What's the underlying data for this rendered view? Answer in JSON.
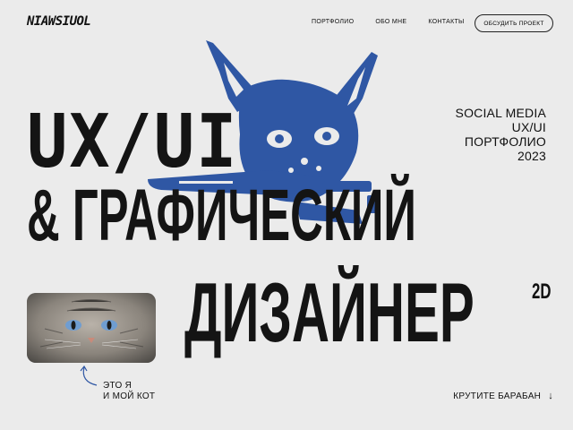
{
  "logo": "NIAWSIUOL",
  "nav": {
    "items": [
      "ПОРТФОЛИО",
      "ОБО МНЕ",
      "КОНТАКТЫ"
    ],
    "cta": "ОБСУДИТЬ ПРОЕКТ"
  },
  "hero": {
    "line1": "UX/UI",
    "line2": "& ГРАФИЧЕСКИЙ",
    "line3": "ДИЗАЙНЕР",
    "superscript": "2D"
  },
  "side": {
    "lines": [
      "SOCIAL MEDIA",
      "UX/UI",
      "ПОРТФОЛИО",
      "2023"
    ]
  },
  "photo": {
    "caption_line1": "ЭТО Я",
    "caption_line2": "И МОЙ КОТ"
  },
  "scroll": {
    "label": "КРУТИТЕ БАРАБАН",
    "icon": "arrow-down-icon"
  },
  "colors": {
    "background": "#ebebeb",
    "text": "#141414",
    "accent_blue": "#2f57a4"
  }
}
